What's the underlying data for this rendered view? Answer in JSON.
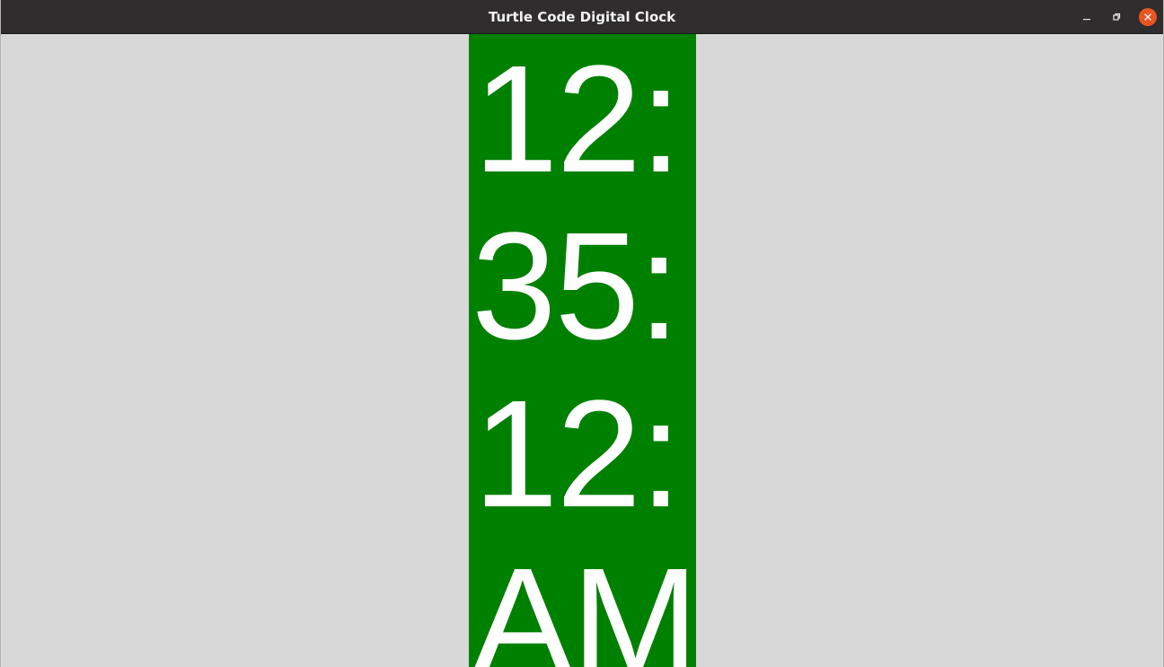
{
  "window": {
    "title": "Turtle Code Digital Clock",
    "controls": {
      "minimize_icon": "minimize-icon",
      "maximize_icon": "restore-icon",
      "close_icon": "close-icon"
    }
  },
  "clock": {
    "lines": [
      "12:",
      "35:",
      "12:",
      "AM"
    ],
    "panel_color": "#008000",
    "text_color": "#ffffff"
  },
  "colors": {
    "titlebar": "#2f2d2d",
    "close_button": "#e95420",
    "canvas_background": "#d8d8d8"
  }
}
